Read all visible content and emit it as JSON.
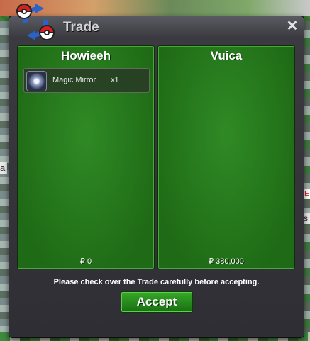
{
  "window": {
    "title": "Trade"
  },
  "close_button": {
    "glyph": "✕",
    "icon": "close-icon"
  },
  "logo": {
    "icon": "trade-pokeball-arrows-icon"
  },
  "left_trader": {
    "name": "Howieeh",
    "money": "₽ 0",
    "items": [
      {
        "name": "Magic Mirror",
        "quantity": "x1",
        "icon": "magic-mirror-icon"
      }
    ]
  },
  "right_trader": {
    "name": "Vuica",
    "money": "₽ 380,000",
    "items": []
  },
  "notice": "Please check over the Trade carefully before accepting.",
  "accept_button": {
    "label": "Accept"
  },
  "background": {
    "left_tag": "a",
    "right_tag": "E",
    "right_tag_2": "s"
  },
  "colors": {
    "panel_green": "#2f8a24",
    "button_green": "#36a828",
    "window_dark": "#2b2b30"
  }
}
